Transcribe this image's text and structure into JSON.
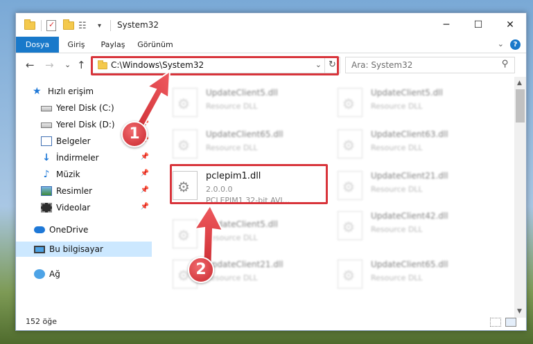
{
  "window": {
    "title": "System32",
    "controls": {
      "minimize": "─",
      "maximize": "☐",
      "close": "✕"
    }
  },
  "ribbon": {
    "tabs": [
      "Dosya",
      "Giriş",
      "Paylaş",
      "Görünüm"
    ],
    "help": "?",
    "expand": "⌄"
  },
  "nav": {
    "back": "←",
    "forward": "→",
    "recent": "⌄",
    "up": "↑",
    "address": "C:\\Windows\\System32",
    "address_dropdown": "⌄",
    "refresh": "↻",
    "search_placeholder": "Ara: System32",
    "search_icon": "⚲"
  },
  "sidebar": {
    "items": [
      {
        "label": "Hızlı erişim",
        "icon": "star-icon",
        "pinned": false
      },
      {
        "label": "Yerel Disk (C:)",
        "icon": "drive-icon",
        "pinned": false
      },
      {
        "label": "Yerel Disk (D:)",
        "icon": "drive-icon",
        "pinned": true
      },
      {
        "label": "Belgeler",
        "icon": "documents-icon",
        "pinned": true
      },
      {
        "label": "İndirmeler",
        "icon": "downloads-icon",
        "pinned": true
      },
      {
        "label": "Müzik",
        "icon": "music-icon",
        "pinned": true
      },
      {
        "label": "Resimler",
        "icon": "pictures-icon",
        "pinned": true
      },
      {
        "label": "Videolar",
        "icon": "videos-icon",
        "pinned": true
      },
      {
        "label": "OneDrive",
        "icon": "onedrive-icon",
        "pinned": false
      },
      {
        "label": "Bu bilgisayar",
        "icon": "computer-icon",
        "pinned": false,
        "selected": true
      },
      {
        "label": "Ağ",
        "icon": "network-icon",
        "pinned": false
      }
    ],
    "pin_glyph": "📌"
  },
  "files": {
    "left_column": [
      {
        "name": "UpdateClient5.dll",
        "type": "Resource DLL"
      },
      {
        "name": "UpdateClient65.dll",
        "type": "Resource DLL"
      },
      {
        "name": "pclepim1.dll",
        "version": "2.0.0.0",
        "description": "PCLEPIM1 32-bit AVI...",
        "highlighted": true
      },
      {
        "name": "UpdateClient5.dll",
        "type": "Resource DLL"
      },
      {
        "name": "UpdateClient21.dll",
        "type": "Resource DLL"
      }
    ],
    "right_column": [
      {
        "name": "UpdateClient5.dll",
        "type": "Resource DLL"
      },
      {
        "name": "UpdateClient63.dll",
        "type": "Resource DLL"
      },
      {
        "name": "UpdateClient21.dll",
        "type": "Resource DLL"
      },
      {
        "name": "UpdateClient42.dll",
        "type": "Resource DLL"
      },
      {
        "name": "UpdateClient65.dll",
        "type": "Resource DLL"
      }
    ]
  },
  "scroll": {
    "up": "▲",
    "down": "▼"
  },
  "status": {
    "count": "152 öğe"
  },
  "annotations": {
    "badge1": "1",
    "badge2": "2",
    "color": "#d8343b"
  }
}
